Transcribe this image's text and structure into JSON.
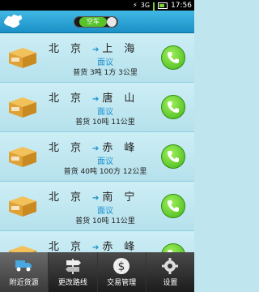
{
  "status": {
    "time": "17:56"
  },
  "header": {
    "toggle_label": "空车"
  },
  "listings": [
    {
      "from": "北京",
      "to": "上海",
      "price": "面议",
      "info": "普货 3吨 1方 3公里"
    },
    {
      "from": "北京",
      "to": "唐山",
      "price": "面议",
      "info": "普货 10吨 11公里"
    },
    {
      "from": "北京",
      "to": "赤峰",
      "price": "面议",
      "info": "普货 40吨 100方 12公里"
    },
    {
      "from": "北京",
      "to": "南宁",
      "price": "面议",
      "info": "普货 10吨 11公里"
    },
    {
      "from": "北京",
      "to": "赤峰",
      "price": "",
      "info": ""
    }
  ],
  "tabs": [
    {
      "label": "附近货源",
      "icon": "box-truck-icon"
    },
    {
      "label": "更改路线",
      "icon": "signpost-icon"
    },
    {
      "label": "交易管理",
      "icon": "dollar-icon"
    },
    {
      "label": "设置",
      "icon": "gear-icon"
    }
  ],
  "colors": {
    "accent": "#1a8fd0",
    "header": "#2aa3d8",
    "call": "#57c22a"
  }
}
